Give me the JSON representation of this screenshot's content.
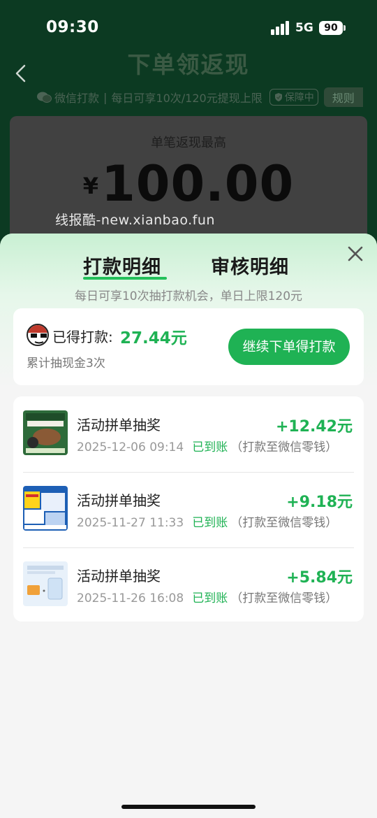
{
  "status_bar": {
    "time": "09:30",
    "network": "5G",
    "battery": "90"
  },
  "background": {
    "title": "下单领返现",
    "payment_method": "微信打款",
    "limit_text": "每日可享10次/120元提现上限",
    "guarantee_badge": "保障中",
    "rules": "规则",
    "amount_label": "单笔返现最高",
    "currency": "¥",
    "amount": "100.00",
    "watermark": "线报酷-new.xianbao.fun"
  },
  "sheet": {
    "tabs": [
      {
        "label": "打款明细",
        "active": true
      },
      {
        "label": "审核明细",
        "active": false
      }
    ],
    "subtitle": "每日可享10次抽打款机会，单日上限120元",
    "summary": {
      "got_label": "已得打款:",
      "got_value": "27.44元",
      "cumulative": "累计抽现金3次",
      "continue_button": "继续下单得打款"
    },
    "records": [
      {
        "title": "活动拼单抽奖",
        "amount": "+12.42元",
        "time": "2025-12-06 09:14",
        "status": "已到账",
        "note": "（打款至微信零钱）",
        "thumb": "cat-food-product"
      },
      {
        "title": "活动拼单抽奖",
        "amount": "+9.18元",
        "time": "2025-11-27 11:33",
        "status": "已到账",
        "note": "（打款至微信零钱）",
        "thumb": "diaper-product"
      },
      {
        "title": "活动拼单抽奖",
        "amount": "+5.84元",
        "time": "2025-11-26 16:08",
        "status": "已到账",
        "note": "（打款至微信零钱）",
        "thumb": "cuktech-product"
      }
    ]
  },
  "colors": {
    "accent": "#1fb254",
    "dim_bg": "#0c3a22"
  }
}
